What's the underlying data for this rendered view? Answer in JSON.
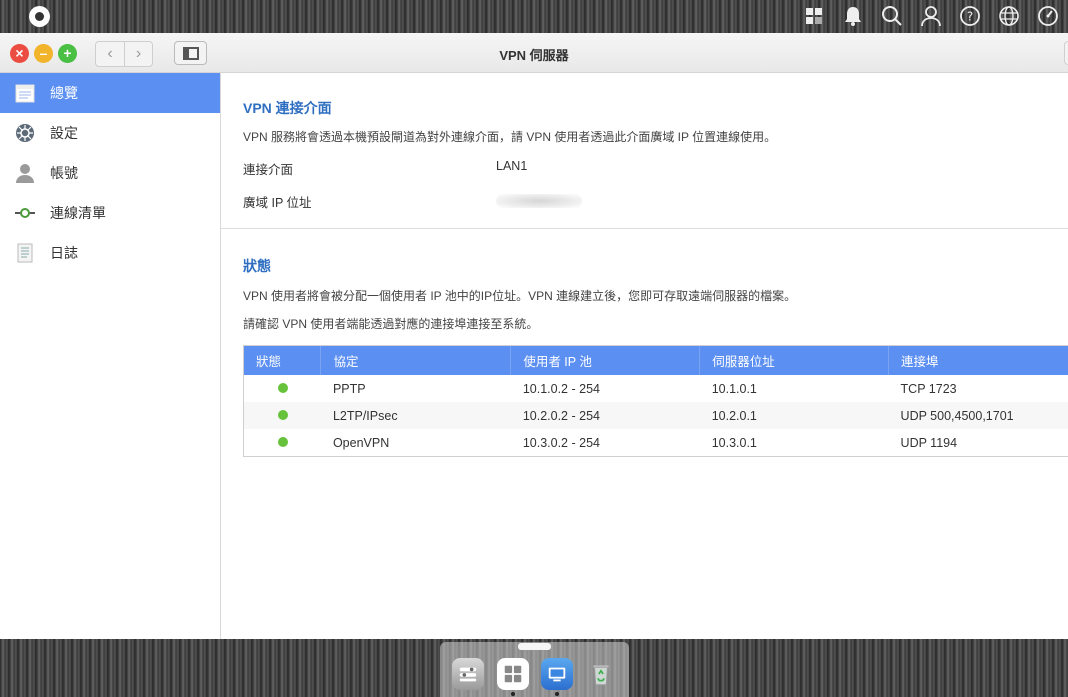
{
  "window": {
    "title": "VPN 伺服器"
  },
  "topbar": {
    "icons": [
      "widgets-icon",
      "bell-icon",
      "search-icon",
      "user-icon",
      "help-icon",
      "globe-icon",
      "dashboard-icon"
    ]
  },
  "sidebar": {
    "items": [
      {
        "label": "總覽",
        "icon": "overview-icon",
        "active": true
      },
      {
        "label": "設定",
        "icon": "settings-icon",
        "active": false
      },
      {
        "label": "帳號",
        "icon": "account-icon",
        "active": false
      },
      {
        "label": "連線清單",
        "icon": "connection-icon",
        "active": false
      },
      {
        "label": "日誌",
        "icon": "log-icon",
        "active": false
      }
    ]
  },
  "interface_section": {
    "title": "VPN 連接介面",
    "description": "VPN 服務將會透過本機預設閘道為對外連線介面，請 VPN 使用者透過此介面廣域 IP 位置連線使用。",
    "rows": [
      {
        "label": "連接介面",
        "value": "LAN1"
      },
      {
        "label": "廣域 IP 位址",
        "value": ""
      }
    ]
  },
  "status_section": {
    "title": "狀態",
    "description1": "VPN 使用者將會被分配一個使用者 IP 池中的IP位址。VPN 連線建立後，您即可存取遠端伺服器的檔案。",
    "description2": "請確認 VPN 使用者端能透過對應的連接埠連接至系統。",
    "table": {
      "headers": [
        "狀態",
        "協定",
        "使用者 IP 池",
        "伺服器位址",
        "連接埠"
      ],
      "rows": [
        {
          "status": "green",
          "protocol": "PPTP",
          "pool": "10.1.0.2 - 254",
          "server": "10.1.0.1",
          "port": "TCP 1723"
        },
        {
          "status": "green",
          "protocol": "L2TP/IPsec",
          "pool": "10.2.0.2 - 254",
          "server": "10.2.0.1",
          "port": "UDP 500,4500,1701"
        },
        {
          "status": "green",
          "protocol": "OpenVPN",
          "pool": "10.3.0.2 - 254",
          "server": "10.3.0.1",
          "port": "UDP 1194"
        }
      ]
    }
  },
  "dock": {
    "apps": [
      "control-panel-icon",
      "app-center-icon",
      "vpn-server-icon",
      "recycle-bin-icon"
    ]
  },
  "colors": {
    "accent": "#5b8ff1",
    "section_title": "#2f6fc1",
    "status_ok": "#66c23a"
  }
}
